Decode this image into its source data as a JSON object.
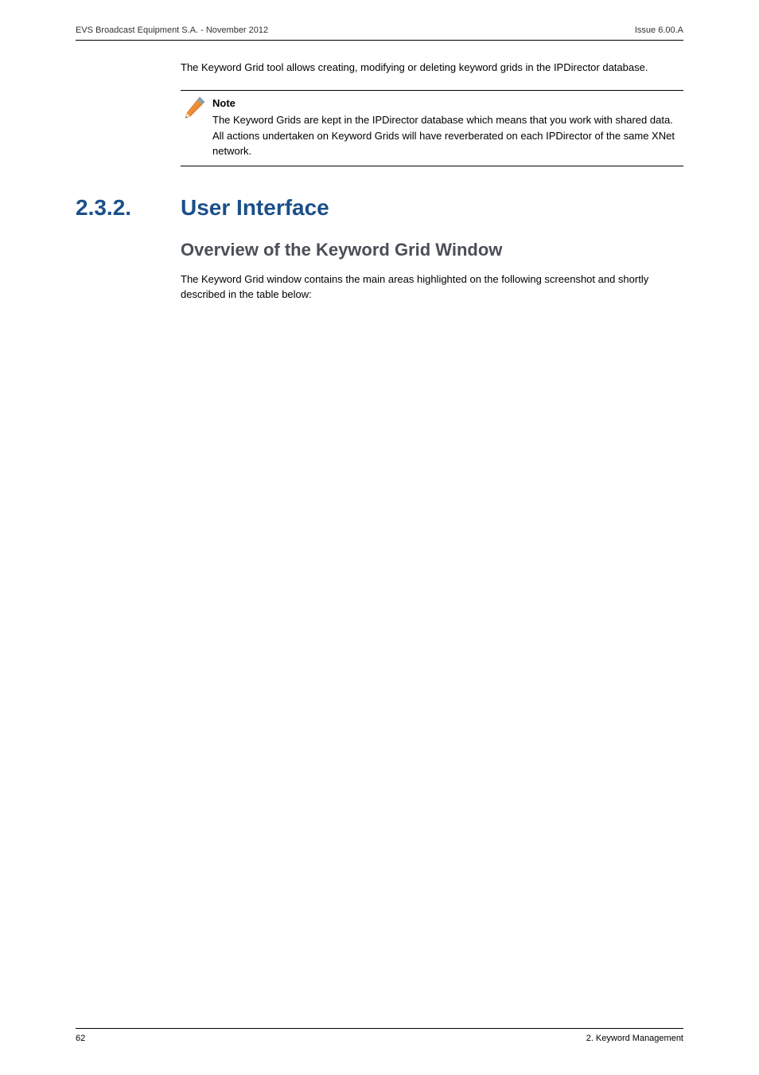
{
  "header": {
    "left": "EVS Broadcast Equipment S.A.  - November 2012",
    "right": "Issue 6.00.A"
  },
  "intro_para": "The Keyword Grid tool allows creating, modifying or deleting keyword grids in the IPDirector database.",
  "note": {
    "title": "Note",
    "body": "The Keyword Grids are kept in the IPDirector database which means that you work with shared data. All actions undertaken on Keyword Grids will have reverberated on each IPDirector of the same XNet network."
  },
  "section": {
    "number": "2.3.2.",
    "title": "User Interface"
  },
  "subheading": "Overview of the Keyword Grid Window",
  "sub_para": "The Keyword Grid window contains the main areas highlighted on the following screenshot and shortly described in the table below:",
  "footer": {
    "left": "62",
    "right": "2. Keyword Management"
  }
}
